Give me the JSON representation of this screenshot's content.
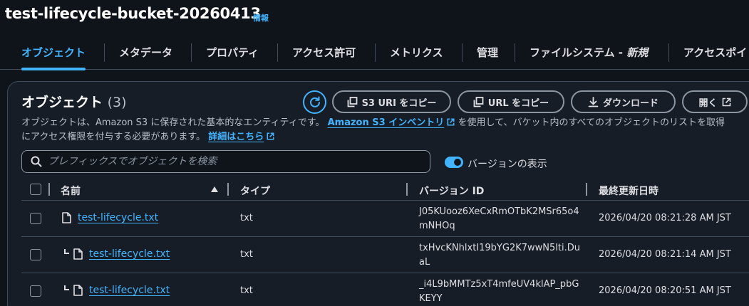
{
  "bucket": {
    "title": "test-lifecycle-bucket-20260413",
    "info_label": "情報"
  },
  "tabs": [
    {
      "label": "オブジェクト",
      "active": true
    },
    {
      "label": "メタデータ"
    },
    {
      "label": "プロパティ"
    },
    {
      "label": "アクセス許可"
    },
    {
      "label": "メトリクス"
    },
    {
      "label": "管理"
    },
    {
      "label": "ファイルシステム - ",
      "suffix": "新規"
    },
    {
      "label": "アクセスポイ"
    }
  ],
  "objects_panel": {
    "title": "オブジェクト",
    "count": "(3)",
    "buttons": {
      "refresh_icon": "refresh-icon",
      "copy_s3_uri": "S3 URI をコピー",
      "copy_url": "URL をコピー",
      "download": "ダウンロード",
      "open": "開く"
    },
    "description": {
      "part1": "オブジェクトは、Amazon S3 に保存された基本的なエンティティです。",
      "inventory_link": "Amazon S3 インベントリ",
      "part2": "を使用して、バケット内のすべてのオブジェクトのリストを取得",
      "part3": "にアクセス権限を付与する必要があります。",
      "details_link": "詳細はこちら"
    },
    "search_placeholder": "プレフィックスでオブジェクトを検索",
    "show_versions_label": "バージョンの表示",
    "show_versions_enabled": true
  },
  "table": {
    "columns": [
      "名前",
      "タイプ",
      "バージョン ID",
      "最終更新日時"
    ],
    "rows": [
      {
        "name": "test-lifecycle.txt",
        "type": "txt",
        "version_id": "J05KUooz6XeCxRmOTbK2MSr65o4mNHOq",
        "modified": "2026/04/20 08:21:28 AM JST"
      },
      {
        "name": "test-lifecycle.txt",
        "type": "txt",
        "version_id": "txHvcKNhlxtI19bYG2K7wwN5lti.DuaL",
        "modified": "2026/04/20 08:21:14 AM JST"
      },
      {
        "name": "test-lifecycle.txt",
        "type": "txt",
        "version_id": "_i4L9bMMTz5xT4mfeUV4klAP_pbGKEYY",
        "modified": "2026/04/20 08:20:51 AM JST"
      }
    ]
  },
  "colors": {
    "accent": "#42b4ff",
    "background": "#0f141a",
    "panel": "#161d26"
  }
}
